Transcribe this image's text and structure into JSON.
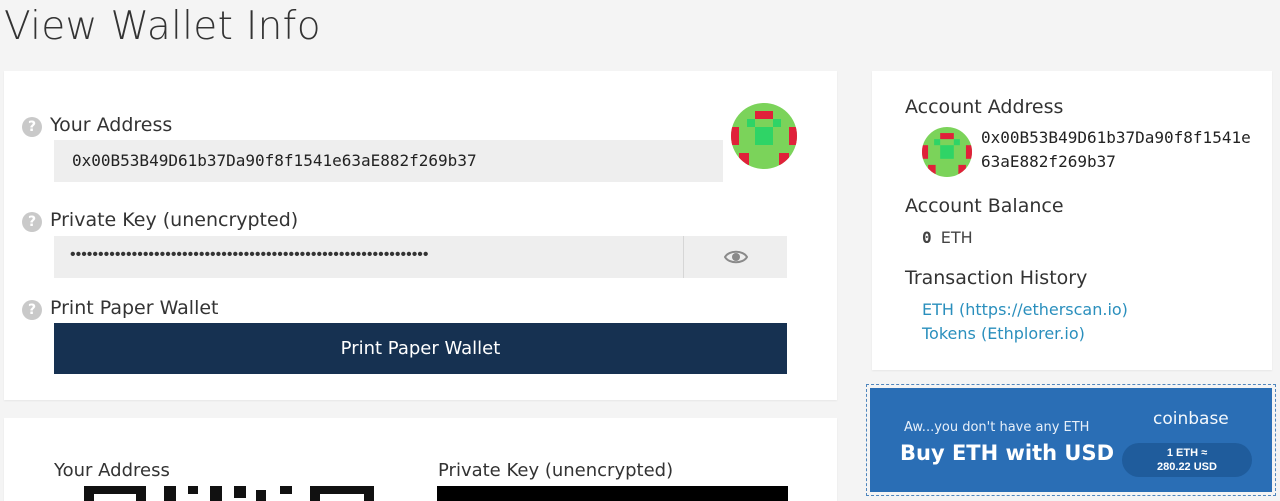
{
  "page": {
    "title": "View Wallet Info"
  },
  "wallet": {
    "address_label": "Your Address",
    "address": "0x00B53B49D61b37Da90f8f1541e63aE882f269b37",
    "private_key_label": "Private Key (unencrypted)",
    "private_key_masked": "••••••••••••••••••••••••••••••••••••••••••••••••••••••••••••••••",
    "print_label": "Print Paper Wallet",
    "print_button": "Print Paper Wallet",
    "help_glyph": "?",
    "eye_icon": "eye-icon"
  },
  "sidebar": {
    "account_address_heading": "Account Address",
    "account_address": "0x00B53B49D61b37Da90f8f1541e63aE882f269b37",
    "balance_heading": "Account Balance",
    "balance_amount": "0",
    "balance_unit": "ETH",
    "history_heading": "Transaction History",
    "links": [
      {
        "label": "ETH (https://etherscan.io)"
      },
      {
        "label": "Tokens (Ethplorer.io)"
      }
    ]
  },
  "coinbase": {
    "message": "Aw...you don't have any ETH",
    "cta": "Buy ETH with USD",
    "brand": "coinbase",
    "rate_line1": "1 ETH ≈",
    "rate_line2": "280.22 USD"
  },
  "paper": {
    "address_label": "Your Address",
    "private_key_label": "Private Key (unencrypted)"
  },
  "colors": {
    "primary_button": "#163151",
    "link": "#2a8fbd",
    "coinbase_blue": "#2a6eb5",
    "identicon_green": "#7bd35a",
    "identicon_red": "#e0213a"
  }
}
